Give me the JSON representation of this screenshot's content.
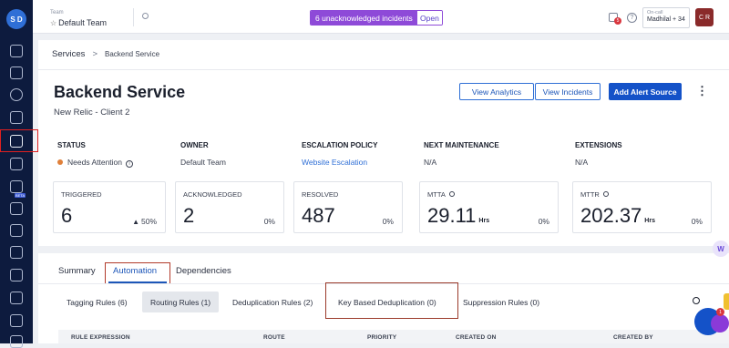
{
  "sidebar": {
    "user_initials": "S D",
    "beta_label": "BETA"
  },
  "topbar": {
    "team_label": "Team",
    "team_value": "Default Team",
    "incidents_text": "6 unacknowledged incidents",
    "incidents_open": "Open",
    "gift_count": "5",
    "oncall_label": "On-call",
    "oncall_value": "Madhilal + 34",
    "user_initials": "C R"
  },
  "breadcrumb": {
    "parent": "Services",
    "separator": ">",
    "current": "Backend Service"
  },
  "service": {
    "title": "Backend Service",
    "subtitle": "New Relic - Client 2"
  },
  "actions": {
    "view_analytics": "View Analytics",
    "view_incidents": "View Incidents",
    "add_alert_source": "Add Alert Source",
    "more": "⋮"
  },
  "meta": {
    "status_h": "STATUS",
    "status_v": "Needs Attention",
    "owner_h": "OWNER",
    "owner_v": "Default Team",
    "escalation_h": "ESCALATION POLICY",
    "escalation_v": "Website Escalation",
    "maintenance_h": "NEXT MAINTENANCE",
    "maintenance_v": "N/A",
    "extensions_h": "EXTENSIONS",
    "extensions_v": "N/A"
  },
  "stats": {
    "triggered": {
      "label": "TRIGGERED",
      "value": "6",
      "pct": "50%"
    },
    "acknowledged": {
      "label": "ACKNOWLEDGED",
      "value": "2",
      "pct": "0%"
    },
    "resolved": {
      "label": "RESOLVED",
      "value": "487",
      "pct": "0%"
    },
    "mtta": {
      "label": "MTTA",
      "value": "29.11",
      "unit": "Hrs",
      "pct": "0%"
    },
    "mttr": {
      "label": "MTTR",
      "value": "202.37",
      "unit": "Hrs",
      "pct": "0%"
    }
  },
  "tabs": {
    "summary": "Summary",
    "automation": "Automation",
    "dependencies": "Dependencies"
  },
  "subtabs": {
    "tagging": "Tagging Rules (6)",
    "routing": "Routing Rules (1)",
    "dedup": "Deduplication Rules (2)",
    "key_dedup": "Key Based Deduplication (0)",
    "suppression": "Suppression Rules (0)"
  },
  "table": {
    "columns": [
      "RULE EXPRESSION",
      "ROUTE",
      "PRIORITY",
      "CREATED ON",
      "CREATED BY"
    ]
  },
  "widgets": {
    "w_badge": "W",
    "chat_count": "1"
  }
}
